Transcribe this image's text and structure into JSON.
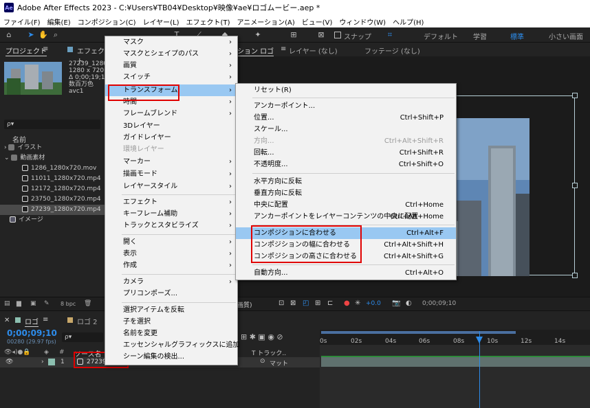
{
  "titlebar": {
    "logo": "Ae",
    "title": "Adobe After Effects 2023 - C:¥Users¥TB04¥Desktop¥映像¥ae¥ロゴムービー.aep *"
  },
  "menubar": [
    "ファイル(F)",
    "編集(E)",
    "コンポジション(C)",
    "レイヤー(L)",
    "エフェクト(T)",
    "アニメーション(A)",
    "ビュー(V)",
    "ウィンドウ(W)",
    "ヘルプ(H)"
  ],
  "toolbar": {
    "snap": "スナップ",
    "workspaces": [
      "デフォルト",
      "学習",
      "標準",
      "小さい画面"
    ]
  },
  "project": {
    "tab": "プロジェクト",
    "tab2": "エフェクト",
    "footage_name": "27239_1280x",
    "footage_info": [
      "1280 x 720 (1",
      "Δ 0;00;19;10,",
      "数百万色",
      "avc1"
    ],
    "search_placeholder": "ρ▾",
    "col_name": "名前",
    "items": [
      {
        "label": "イラスト",
        "type": "folder"
      },
      {
        "label": "動画素材",
        "type": "folder-open"
      },
      {
        "label": "1286_1280x720.mov",
        "type": "file"
      },
      {
        "label": "11011_1280x720.mp4",
        "type": "file"
      },
      {
        "label": "12172_1280x720.mp4",
        "type": "file"
      },
      {
        "label": "23750_1280x720.mp4",
        "type": "file"
      },
      {
        "label": "27239_1280x720.mp4",
        "type": "file",
        "selected": true
      },
      {
        "label": "イメージ",
        "type": "comp"
      }
    ],
    "bpc": "8 bpc"
  },
  "comp": {
    "tab": "ション ロゴ",
    "layer_tab": "レイヤー (なし)",
    "footage_tab": "フッテージ (なし)",
    "quality": "画質)",
    "exposure": "+0.0",
    "timecode": "0;00;09;10"
  },
  "timeline": {
    "tab1": "ロゴ",
    "tab2": "ロゴ 2",
    "timecode": "0;00;09;10",
    "fps": "00280 (29.97 fps)",
    "col_source": "ソース名",
    "col_track": "T トラック..",
    "layer_num": "1",
    "layer_name": "27239...",
    "layer_matte": "マット",
    "ruler": [
      "0s",
      "02s",
      "04s",
      "06s",
      "08s",
      "10s",
      "12s",
      "14s"
    ],
    "playhead_time_s": 9.3
  },
  "context_menu": {
    "items": [
      {
        "label": "マスク",
        "arrow": true
      },
      {
        "label": "マスクとシェイプのパス",
        "arrow": true
      },
      {
        "label": "画質",
        "arrow": true
      },
      {
        "label": "スイッチ",
        "arrow": true
      },
      {
        "label": "トランスフォーム",
        "arrow": true,
        "highlight": true
      },
      {
        "label": "時間",
        "arrow": true
      },
      {
        "label": "フレームブレンド",
        "arrow": true
      },
      {
        "label": "3Dレイヤー"
      },
      {
        "label": "ガイドレイヤー"
      },
      {
        "label": "環境レイヤー",
        "disabled": true
      },
      {
        "label": "マーカー",
        "arrow": true
      },
      {
        "label": "描画モード",
        "arrow": true
      },
      {
        "label": "レイヤースタイル",
        "arrow": true
      },
      {
        "label": "エフェクト",
        "arrow": true,
        "sep_before": true
      },
      {
        "label": "キーフレーム補助",
        "arrow": true
      },
      {
        "label": "トラックとスタビライズ",
        "arrow": true
      },
      {
        "label": "開く",
        "arrow": true,
        "sep_before": true
      },
      {
        "label": "表示",
        "arrow": true
      },
      {
        "label": "作成",
        "arrow": true
      },
      {
        "label": "カメラ",
        "arrow": true,
        "sep_before": true
      },
      {
        "label": "プリコンポーズ..."
      },
      {
        "label": "選択アイテムを反転",
        "sep_before": true
      },
      {
        "label": "子を選択"
      },
      {
        "label": "名前を変更"
      },
      {
        "label": "エッセンシャルグラフィックスに追加"
      },
      {
        "label": "シーン編集の検出..."
      }
    ]
  },
  "submenu": {
    "items": [
      {
        "label": "リセット(R)",
        "shortcut": ""
      },
      {
        "label": "アンカーポイント...",
        "shortcut": "",
        "sep_before": true
      },
      {
        "label": "位置...",
        "shortcut": "Ctrl+Shift+P"
      },
      {
        "label": "スケール...",
        "shortcut": ""
      },
      {
        "label": "方向...",
        "shortcut": "Ctrl+Alt+Shift+R",
        "disabled": true
      },
      {
        "label": "回転...",
        "shortcut": "Ctrl+Shift+R"
      },
      {
        "label": "不透明度...",
        "shortcut": "Ctrl+Shift+O"
      },
      {
        "label": "水平方向に反転",
        "shortcut": "",
        "sep_before": true
      },
      {
        "label": "垂直方向に反転",
        "shortcut": ""
      },
      {
        "label": "中央に配置",
        "shortcut": "Ctrl+Home"
      },
      {
        "label": "アンカーポイントをレイヤーコンテンツの中央に配置",
        "shortcut": "Ctrl+Alt+Home"
      },
      {
        "label": "コンポジションに合わせる",
        "shortcut": "Ctrl+Alt+F",
        "highlight": true,
        "sep_before": true
      },
      {
        "label": "コンポジションの幅に合わせる",
        "shortcut": "Ctrl+Alt+Shift+H"
      },
      {
        "label": "コンポジションの高さに合わせる",
        "shortcut": "Ctrl+Alt+Shift+G"
      },
      {
        "label": "自動方向...",
        "shortcut": "Ctrl+Alt+O",
        "sep_before": true
      }
    ]
  },
  "colors": {
    "accent": "#2d8ceb",
    "highlight": "#99c8f2",
    "annotation": "#e00000"
  }
}
